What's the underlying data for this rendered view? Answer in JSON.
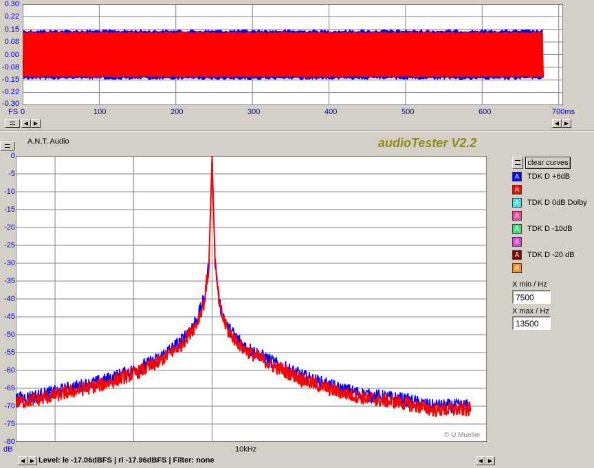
{
  "top_chart": {
    "y_ticks": [
      "0.30",
      "0.22",
      "0.15",
      "0.08",
      "0.00",
      "-0.08",
      "-0.15",
      "-0.22",
      "-0.30"
    ],
    "y_unit": "FS",
    "x_ticks": [
      "0",
      "100",
      "200",
      "300",
      "400",
      "500",
      "600",
      "700"
    ],
    "x_unit": "700ms"
  },
  "header": {
    "device": "A.N.T. Audio",
    "app_title": "audioTester V2.2"
  },
  "main_chart": {
    "y_ticks": [
      "0",
      "-5",
      "-10",
      "-15",
      "-20",
      "-25",
      "-30",
      "-35",
      "-40",
      "-45",
      "-50",
      "-55",
      "-60",
      "-65",
      "-70",
      "-75",
      "-80"
    ],
    "y_unit": "dB",
    "x_center_label": "10kHz",
    "copyright": "© U.Mueller"
  },
  "legend": {
    "clear_label": "clear curves",
    "items": [
      {
        "glyph": "A",
        "color": "#0000ff",
        "label": "TDK D +6dB"
      },
      {
        "glyph": "A",
        "color": "#ff0000",
        "label": ""
      },
      {
        "glyph": "A",
        "color": "#40e0e0",
        "label": "TDK D 0dB Dolby"
      },
      {
        "glyph": "A",
        "color": "#ff40a0",
        "label": ""
      },
      {
        "glyph": "A",
        "color": "#40e080",
        "label": "TDK D -10dB"
      },
      {
        "glyph": "A",
        "color": "#e040e0",
        "label": ""
      },
      {
        "glyph": "A",
        "color": "#800000",
        "label": "TDK D -20 dB"
      },
      {
        "glyph": "A",
        "color": "#ff9020",
        "label": ""
      }
    ],
    "xmin_label": "X min / Hz",
    "xmin_value": "7500",
    "xmax_label": "X max / Hz",
    "xmax_value": "13500"
  },
  "status": {
    "text": "Level: le -17.06dBFS | ri -17.96dBFS | Filter: none"
  },
  "chart_data": [
    {
      "type": "line",
      "title": "",
      "xlabel": "ms",
      "ylabel": "FS",
      "xlim": [
        0,
        700
      ],
      "ylim": [
        -0.3,
        0.3
      ],
      "series": [
        {
          "name": "",
          "color": "#0000ff",
          "x": [
            0,
            680
          ],
          "envelope": [
            -0.14,
            0.14
          ]
        },
        {
          "name": "",
          "color": "#ff0000",
          "x": [
            0,
            680
          ],
          "envelope": [
            -0.13,
            0.13
          ]
        }
      ]
    },
    {
      "type": "line",
      "title": "",
      "xlabel": "Hz",
      "ylabel": "dB",
      "xlim": [
        7500,
        13500
      ],
      "ylim": [
        -80,
        0
      ],
      "series": [
        {
          "name": "TDK D +6dB",
          "color": "#0000ff",
          "x": [
            7500,
            7800,
            8200,
            8600,
            9000,
            9300,
            9600,
            9800,
            9900,
            9960,
            10000,
            10040,
            10100,
            10200,
            10400,
            10800,
            11200,
            11600,
            12000,
            12400,
            12800,
            13300
          ],
          "y": [
            -68,
            -67,
            -65,
            -63,
            -60,
            -57,
            -52,
            -46,
            -40,
            -30,
            0,
            -30,
            -42,
            -48,
            -53,
            -58,
            -62,
            -65,
            -67,
            -68,
            -70,
            -70
          ]
        },
        {
          "name": "",
          "color": "#ff0000",
          "x": [
            7500,
            7800,
            8200,
            8600,
            9000,
            9300,
            9600,
            9800,
            9900,
            9960,
            10000,
            10040,
            10100,
            10200,
            10400,
            10800,
            11200,
            11600,
            12000,
            12400,
            12800,
            13300
          ],
          "y": [
            -69,
            -68,
            -66,
            -64,
            -61,
            -58,
            -53,
            -47,
            -41,
            -31,
            0,
            -31,
            -43,
            -49,
            -54,
            -59,
            -63,
            -66,
            -68,
            -69,
            -71,
            -71
          ]
        }
      ]
    }
  ]
}
